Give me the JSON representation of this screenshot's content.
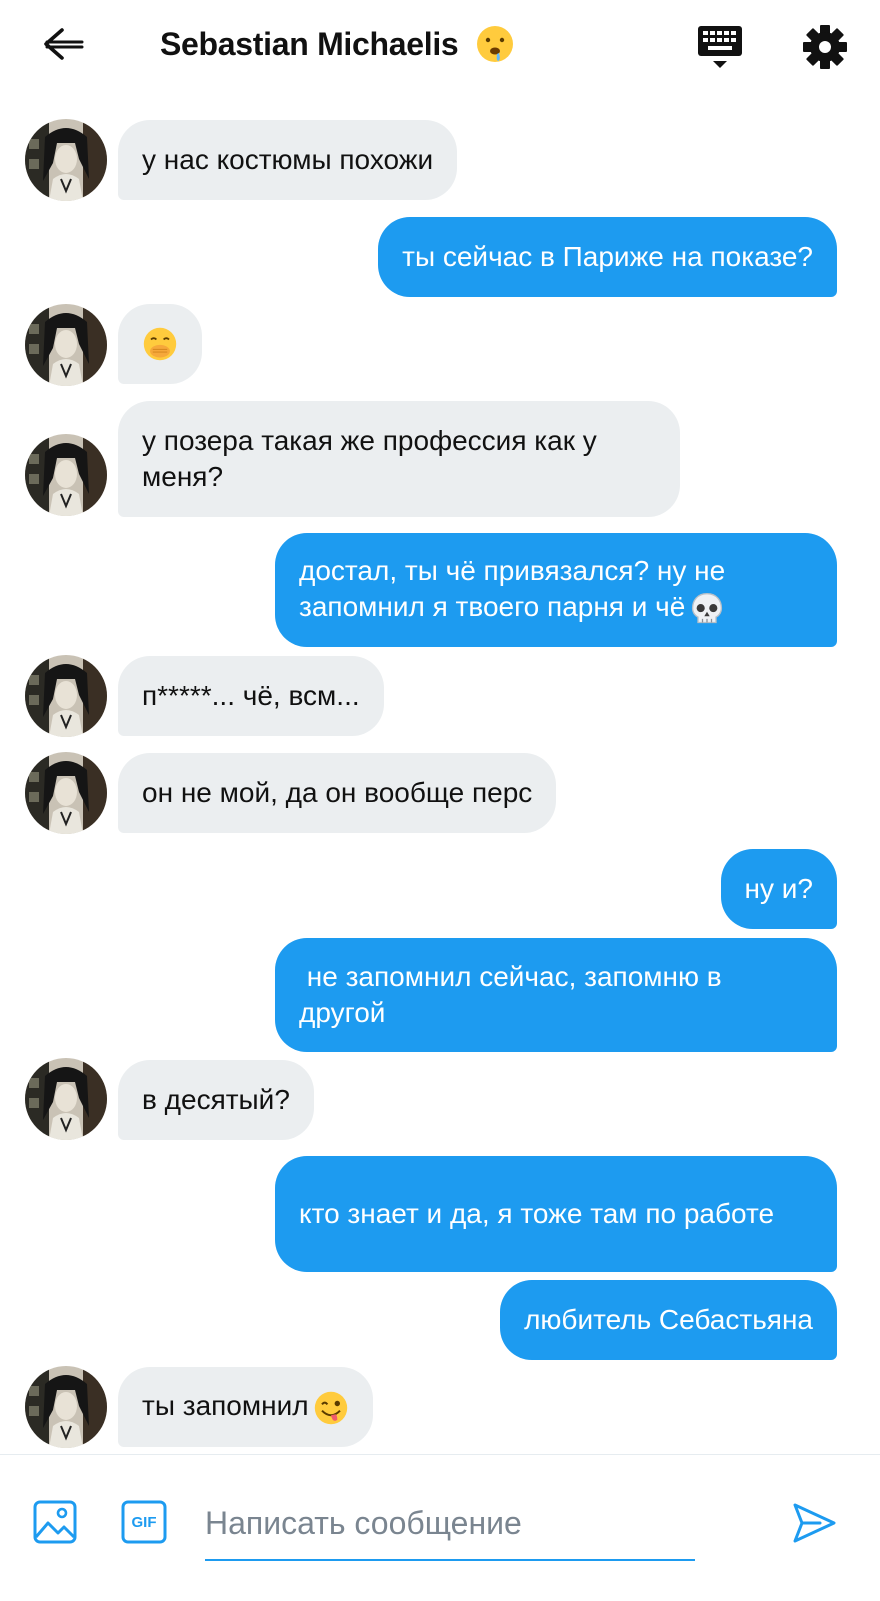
{
  "header": {
    "title": "Sebastian Michaelis",
    "title_emoji": "drooling-face",
    "back_icon": "arrow-left-icon",
    "keyboard_icon": "keyboard-icon",
    "settings_icon": "gear-icon"
  },
  "messages": [
    {
      "side": "in",
      "text": "у нас костюмы похожи"
    },
    {
      "side": "out",
      "text": "ты сейчас в Париже на показе?"
    },
    {
      "side": "in",
      "text": "",
      "emoji": "face-with-hand-over-mouth"
    },
    {
      "side": "in",
      "text": "у позера такая же профессия как у меня?"
    },
    {
      "side": "out",
      "text": "достал, ты чё привязался? ну не запомнил я твоего парня и чё",
      "emoji": "skull"
    },
    {
      "side": "in",
      "text": "п*****... чё, всм..."
    },
    {
      "side": "in",
      "text": "он не мой, да он вообще перс"
    },
    {
      "side": "out",
      "text": "ну и?"
    },
    {
      "side": "out",
      "text": " не запомнил сейчас, запомню в другой"
    },
    {
      "side": "in",
      "text": "в десятый?"
    },
    {
      "side": "out",
      "text": "кто знает и да, я тоже там по работе"
    },
    {
      "side": "out",
      "text": "любитель Себастьяна"
    },
    {
      "side": "in",
      "text": "ты запомнил",
      "emoji": "winking-face-with-tongue"
    }
  ],
  "composer": {
    "placeholder": "Написать сообщение",
    "image_icon": "image-icon",
    "gif_label": "GIF",
    "send_icon": "send-icon"
  },
  "colors": {
    "accent": "#1d9bf0",
    "incoming_bubble": "#ebeef0",
    "outgoing_text": "#ffffff"
  }
}
